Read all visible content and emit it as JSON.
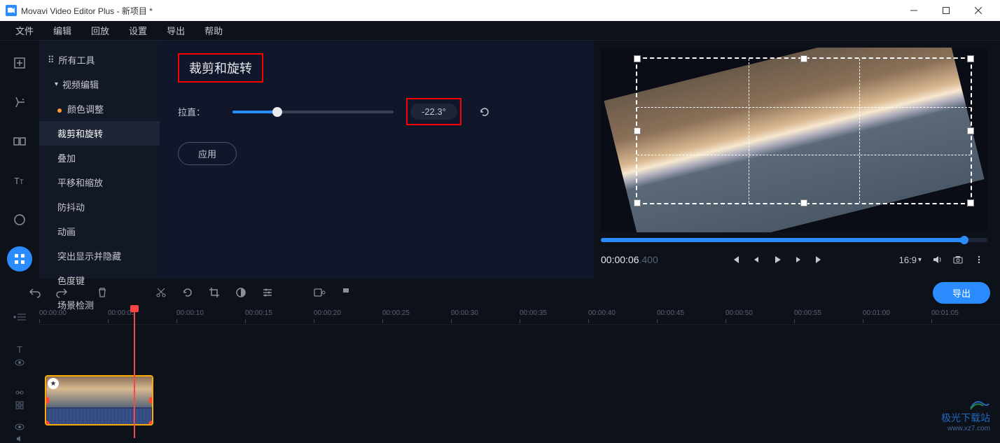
{
  "window": {
    "title": "Movavi Video Editor Plus - 新项目 *"
  },
  "menus": [
    "文件",
    "编辑",
    "回放",
    "设置",
    "导出",
    "帮助"
  ],
  "sidebar": {
    "all_tools": "所有工具",
    "video_edit": "视频编辑",
    "items": [
      {
        "label": "颜色调整"
      },
      {
        "label": "裁剪和旋转"
      },
      {
        "label": "叠加"
      },
      {
        "label": "平移和缩放"
      },
      {
        "label": "防抖动"
      },
      {
        "label": "动画"
      },
      {
        "label": "突出显示并隐藏"
      },
      {
        "label": "色度键"
      },
      {
        "label": "场景检测"
      }
    ]
  },
  "panel": {
    "title": "裁剪和旋转",
    "straighten_label": "拉直：",
    "value": "-22.3°",
    "apply": "应用"
  },
  "preview": {
    "time_main": "00:00:06",
    "time_ms": ".400",
    "aspect": "16:9"
  },
  "toolbar": {
    "export": "导出"
  },
  "ruler": [
    "00:00:00",
    "00:00:05",
    "00:00:10",
    "00:00:15",
    "00:00:20",
    "00:00:25",
    "00:00:30",
    "00:00:35",
    "00:00:40",
    "00:00:45",
    "00:00:50",
    "00:00:55",
    "00:01:00",
    "00:01:05"
  ],
  "watermark": {
    "name": "极光下载站",
    "url": "www.xz7.com"
  }
}
